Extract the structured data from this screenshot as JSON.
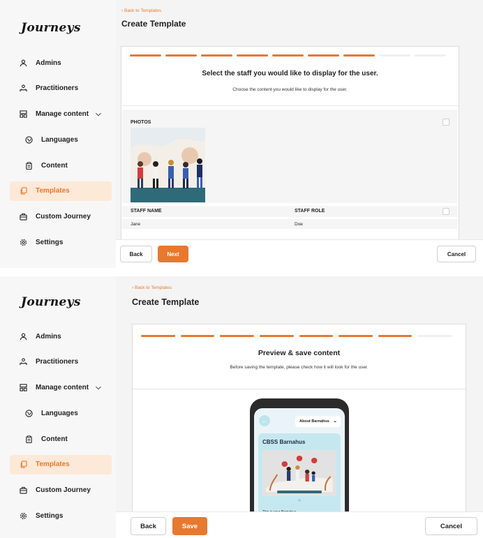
{
  "app": {
    "logo": "Journeys"
  },
  "sidebar": {
    "items": [
      {
        "label": "Admins",
        "icon": "user-icon"
      },
      {
        "label": "Practitioners",
        "icon": "users-icon"
      },
      {
        "label": "Manage content",
        "icon": "content-icon",
        "expanded": true
      },
      {
        "label": "Languages",
        "icon": "globe-icon"
      },
      {
        "label": "Content",
        "icon": "clipboard-icon"
      },
      {
        "label": "Templates",
        "icon": "copy-icon",
        "active": true
      },
      {
        "label": "Custom Journey",
        "icon": "briefcase-icon"
      },
      {
        "label": "Settings",
        "icon": "gear-icon"
      }
    ]
  },
  "header": {
    "back_link": "Back to Templates",
    "title": "Create Template"
  },
  "colors": {
    "accent": "#e8782e",
    "active_bg": "#fde9d8",
    "sidebar_bg": "#f7f7f7"
  },
  "screen1": {
    "progress": {
      "total": 9,
      "completed": 7
    },
    "step_title": "Select the staff you would like to display for the user.",
    "step_subtitle": "Choose the content you would like to display for the user.",
    "photos_label": "PHOTOS",
    "staff_columns": [
      "STAFF NAME",
      "STAFF ROLE"
    ],
    "staff_row": [
      "Jane",
      "Doe"
    ],
    "buttons": {
      "back": "Back",
      "next": "Next",
      "cancel": "Cancel"
    }
  },
  "screen2": {
    "progress": {
      "total": 8,
      "completed": 7
    },
    "step_title": "Preview & save content",
    "step_subtitle": "Before saving the template, please check how it will look for the user.",
    "preview": {
      "select_value": "About Barnahus",
      "card_title": "CBSS Barnahus",
      "card_text": "This is your Barnahus"
    },
    "buttons": {
      "back": "Back",
      "save": "Save",
      "cancel": "Cancel"
    }
  }
}
